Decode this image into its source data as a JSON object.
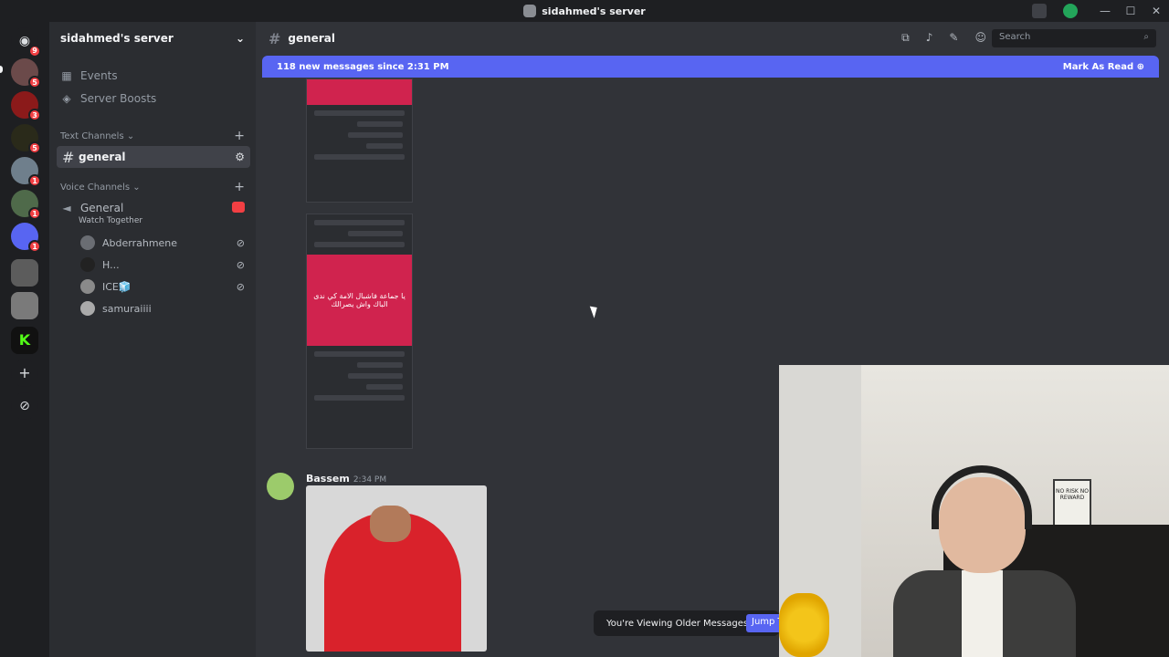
{
  "window": {
    "title": "sidahmed's server",
    "controls": [
      "—",
      "☐",
      "✕"
    ]
  },
  "servers": [
    {
      "badge": "9",
      "icon": "discord-icon"
    },
    {
      "badge": "5"
    },
    {
      "badge": "3"
    },
    {
      "badge": "5"
    },
    {
      "badge": "1"
    },
    {
      "badge": "1"
    },
    {
      "badge": "1"
    },
    {
      "badge": ""
    },
    {
      "badge": ""
    },
    {
      "badge": ""
    }
  ],
  "sidebar": {
    "server_name": "sidahmed's server",
    "events": "Events",
    "boosts": "Server Boosts",
    "text_category": "Text Channels",
    "active_channel": "general",
    "voice_category": "Voice Channels",
    "voice_channel": "General",
    "voice_activity": "Watch Together",
    "voice_users": [
      "Abderrahmene",
      "H...",
      "ICE🧊",
      "samuraiiii"
    ]
  },
  "header": {
    "channel": "general",
    "search_placeholder": "Search"
  },
  "new_messages_bar": {
    "text": "118 new messages since 2:31 PM",
    "action": "Mark As Read"
  },
  "attachments": {
    "red_text": "يا جماعة فاشبال الامة كي ندى الباك واش يصرالك"
  },
  "message": {
    "author": "Bassem",
    "time": "2:34 PM"
  },
  "older_bar": {
    "text": "You're Viewing Older Messages",
    "jump": "Jump T"
  },
  "webcam": {
    "poster_text": "NO RISK NO REWARD"
  }
}
